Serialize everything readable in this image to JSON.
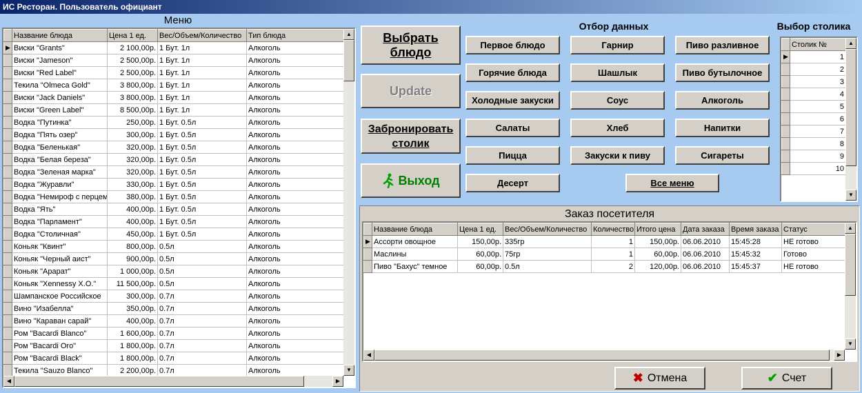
{
  "window": {
    "title": "ИС Ресторан. Пользователь официант"
  },
  "menu": {
    "title": "Меню",
    "columns": [
      "Название блюда",
      "Цена 1 ед.",
      "Вес/Объем/Количество",
      "Тип блюда"
    ],
    "rows": [
      [
        "Виски \"Grants\"",
        "2 100,00р.",
        "1 Бут. 1л",
        "Алкоголь"
      ],
      [
        "Виски \"Jameson\"",
        "2 500,00р.",
        "1 Бут. 1л",
        "Алкоголь"
      ],
      [
        "Виски \"Red Label\"",
        "2 500,00р.",
        "1 Бут. 1л",
        "Алкоголь"
      ],
      [
        "Текила \"Olmeca Gold\"",
        "3 800,00р.",
        "1 Бут. 1л",
        "Алкоголь"
      ],
      [
        "Виски \"Jack Daniels\"",
        "3 800,00р.",
        "1 Бут. 1л",
        "Алкоголь"
      ],
      [
        "Виски \"Green Label\"",
        "8 500,00р.",
        "1 Бут. 1л",
        "Алкоголь"
      ],
      [
        "Водка \"Путинка\"",
        "250,00р.",
        "1 Бут. 0.5л",
        "Алкоголь"
      ],
      [
        "Водка \"Пять озер\"",
        "300,00р.",
        "1 Бут. 0.5л",
        "Алкоголь"
      ],
      [
        "Водка \"Беленькая\"",
        "320,00р.",
        "1 Бут. 0.5л",
        "Алкоголь"
      ],
      [
        "Водка \"Белая береза\"",
        "320,00р.",
        "1 Бут. 0.5л",
        "Алкоголь"
      ],
      [
        "Водка \"Зеленая марка\"",
        "320,00р.",
        "1 Бут. 0.5л",
        "Алкоголь"
      ],
      [
        "Водка \"Журавли\"",
        "330,00р.",
        "1 Бут. 0.5л",
        "Алкоголь"
      ],
      [
        "Водка \"Немироф с перцем\"",
        "380,00р.",
        "1 Бут. 0.5л",
        "Алкоголь"
      ],
      [
        "Водка \"Ять\"",
        "400,00р.",
        "1 Бут. 0.5л",
        "Алкоголь"
      ],
      [
        "Водка \"Парламент\"",
        "400,00р.",
        "1 Бут. 0.5л",
        "Алкоголь"
      ],
      [
        "Водка \"Столичная\"",
        "450,00р.",
        "1 Бут. 0.5л",
        "Алкоголь"
      ],
      [
        "Коньяк \"Квинт\"",
        "800,00р.",
        "0.5л",
        "Алкоголь"
      ],
      [
        "Коньяк \"Черный аист\"",
        "900,00р.",
        "0.5л",
        "Алкоголь"
      ],
      [
        "Коньяк \"Арарат\"",
        "1 000,00р.",
        "0.5л",
        "Алкоголь"
      ],
      [
        "Коньяк \"Xennessy X.O.\"",
        "11 500,00р.",
        "0.5л",
        "Алкоголь"
      ],
      [
        "Шампанское Российское",
        "300,00р.",
        "0.7л",
        "Алкоголь"
      ],
      [
        "Вино \"Изабелла\"",
        "350,00р.",
        "0.7л",
        "Алкоголь"
      ],
      [
        "Вино \"Караван сарай\"",
        "400,00р.",
        "0.7л",
        "Алкоголь"
      ],
      [
        "Ром \"Bacardi Blanco\"",
        "1 600,00р.",
        "0.7л",
        "Алкоголь"
      ],
      [
        "Ром \"Bacardi Oro\"",
        "1 800,00р.",
        "0.7л",
        "Алкоголь"
      ],
      [
        "Ром \"Bacardi Black\"",
        "1 800,00р.",
        "0.7л",
        "Алкоголь"
      ],
      [
        "Текила \"Sauzo Blanco\"",
        "2 200,00р.",
        "0.7л",
        "Алкоголь"
      ]
    ]
  },
  "actions": {
    "choose_line1": "Выбрать",
    "choose_line2": "блюдо",
    "update": "Update",
    "reserve_line1": "Забронировать",
    "reserve_line2": "столик",
    "exit": "Выход"
  },
  "filter": {
    "title": "Отбор данных",
    "col1": [
      "Первое блюдо",
      "Горячие блюда",
      "Холодные закуски",
      "Салаты",
      "Пицца",
      "Десерт"
    ],
    "col2": [
      "Гарнир",
      "Шашлык",
      "Соус",
      "Хлеб",
      "Закуски к пиву"
    ],
    "col3": [
      "Пиво разливное",
      "Пиво бутылочное",
      "Алкоголь",
      "Напитки",
      "Сигареты"
    ],
    "all": "Все меню"
  },
  "tables": {
    "title": "Выбор столика",
    "column": "Столик №",
    "rows": [
      "1",
      "2",
      "3",
      "4",
      "5",
      "6",
      "7",
      "8",
      "9",
      "10"
    ]
  },
  "order": {
    "title": "Заказ посетителя",
    "columns": [
      "Название блюда",
      "Цена 1 ед.",
      "Вес/Объем/Количество",
      "Количество",
      "Итого цена",
      "Дата заказа",
      "Время заказа",
      "Статус"
    ],
    "rows": [
      [
        "Ассорти овощное",
        "150,00р.",
        "335гр",
        "1",
        "150,00р.",
        "06.06.2010",
        "15:45:28",
        "НЕ готово"
      ],
      [
        "Маслины",
        "60,00р.",
        "75гр",
        "1",
        "60,00р.",
        "06.06.2010",
        "15:45:32",
        "Готово"
      ],
      [
        "Пиво \"Бахус\" темное",
        "60,00р.",
        "0.5л",
        "2",
        "120,00р.",
        "06.06.2010",
        "15:45:37",
        "НЕ готово"
      ]
    ]
  },
  "footer": {
    "cancel": "Отмена",
    "check": "Счет"
  },
  "colors": {
    "background": "#a6caf0",
    "button_face": "#d4d0c8",
    "exit_green": "#008000",
    "cancel_red": "#c00000"
  }
}
